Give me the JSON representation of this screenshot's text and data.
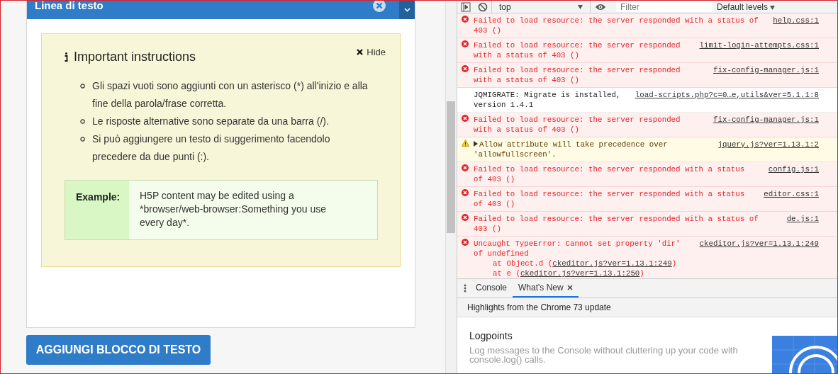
{
  "editor": {
    "title": "Linea di testo",
    "instructions": {
      "title": "Important instructions",
      "hide_label": "Hide",
      "items": [
        "Gli spazi vuoti sono aggiunti con un asterisco (*) all'inizio e alla fine della parola/frase corretta.",
        "Le risposte alternative sono separate da una barra (/).",
        "Si può aggiungere un testo di suggerimento facendolo precedere da due punti (:)."
      ],
      "example": {
        "label": "Example:",
        "text": "H5P content may be edited using a *browser/web-browser:Something you use every day*."
      }
    },
    "add_button": "AGGIUNGI BLOCCO DI TESTO"
  },
  "devtools": {
    "context": "top",
    "filter_placeholder": "Filter",
    "levels": "Default levels",
    "messages": [
      {
        "kind": "error",
        "lines": [
          "Failed to load resource: the server responded with a status of",
          "403 ()"
        ],
        "source": "help.css:1"
      },
      {
        "kind": "error",
        "lines": [
          "Failed to load resource: the server responded",
          "with a status of 403 ()"
        ],
        "source": "limit-login-attempts.css:1"
      },
      {
        "kind": "error",
        "lines": [
          "Failed to load resource: the server responded",
          "with a status of 403 ()"
        ],
        "source": "fix-config-manager.js:1"
      },
      {
        "kind": "info",
        "lines": [
          "JQMIGRATE: Migrate is installed,",
          "version 1.4.1"
        ],
        "source": "load-scripts.php?c=0…e,utils&ver=5.1.1:8"
      },
      {
        "kind": "error",
        "lines": [
          "Failed to load resource: the server responded",
          "with a status of 403 ()"
        ],
        "source": "fix-config-manager.js:1"
      },
      {
        "kind": "warning",
        "lines": [
          "Allow attribute will take precedence over",
          "'allowfullscreen'."
        ],
        "source": "jquery.js?ver=1.13.1:2"
      },
      {
        "kind": "error",
        "lines": [
          "Failed to load resource: the server responded with a status",
          "of 403 ()"
        ],
        "source": "config.js:1"
      },
      {
        "kind": "error",
        "lines": [
          "Failed to load resource: the server responded with a status",
          "of 403 ()"
        ],
        "source": "editor.css:1"
      },
      {
        "kind": "error",
        "lines": [
          "Failed to load resource: the server responded with a status of",
          "403 ()"
        ],
        "source": "de.js:1"
      },
      {
        "kind": "error",
        "lines": [
          "Uncaught TypeError: Cannot set property 'dir'",
          "of undefined"
        ],
        "source": "ckeditor.js?ver=1.13.1:249",
        "stack": [
          {
            "prefix": "at Object.d (",
            "link": "ckeditor.js?ver=1.13.1:249",
            "suffix": ")"
          },
          {
            "prefix": "at e (",
            "link": "ckeditor.js?ver=1.13.1:250",
            "suffix": ")"
          }
        ]
      }
    ],
    "drawer_tabs": [
      {
        "label": "Console",
        "selected": false,
        "closable": false
      },
      {
        "label": "What's New",
        "selected": true,
        "closable": true
      }
    ],
    "whats_new": {
      "heading": "Highlights from the Chrome 73 update",
      "feature_title": "Logpoints",
      "feature_text": "Log messages to the Console without cluttering up your code with console.log() calls."
    }
  }
}
